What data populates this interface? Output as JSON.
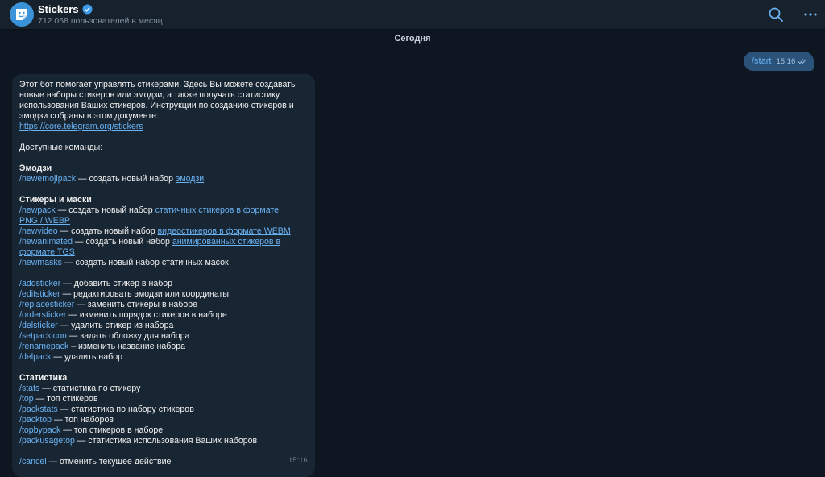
{
  "header": {
    "title": "Stickers",
    "subtitle": "712 068 пользователей в месяц",
    "icons": [
      "bot-avatar-icon",
      "verified-icon",
      "search-icon",
      "more-icon"
    ]
  },
  "chat": {
    "date_label": "Сегодня",
    "outgoing": {
      "text": "/start",
      "time": "15:16",
      "status": "read"
    },
    "incoming": {
      "time": "15:16",
      "intro": [
        "Этот бот помогает управлять стикерами. Здесь Вы можете создавать",
        "новые наборы стикеров или эмодзи, а также получать статистику",
        "использования Ваших стикеров. Инструкции по созданию стикеров и",
        "эмодзи собраны в этом документе:"
      ],
      "doc_link": "https://core.telegram.org/stickers",
      "commands_heading": "Доступные команды:",
      "emoji_heading": "Эмодзи",
      "newemojipack": {
        "cmd": "/newemojipack",
        "desc": " — создать новый набор ",
        "link": "эмодзи"
      },
      "stickers_heading": "Стикеры и маски",
      "newpack": {
        "cmd": "/newpack",
        "desc": " — создать новый набор ",
        "link1": "статичных стикеров в формате ",
        "link2": "PNG / WEBP"
      },
      "newvideo": {
        "cmd": "/newvideo",
        "desc": " — создать новый набор ",
        "link": "видеостикеров в формате WEBM"
      },
      "newanimated": {
        "cmd": "/newanimated",
        "desc": " — создать новый набор ",
        "link1": "анимированных стикеров в",
        "link2": "формате TGS"
      },
      "newmasks": {
        "cmd": "/newmasks",
        "desc": " — создать новый набор статичных масок"
      },
      "edit_commands": [
        {
          "cmd": "/addsticker",
          "desc": " — добавить стикер в набор"
        },
        {
          "cmd": "/editsticker",
          "desc": " — редактировать эмодзи или координаты"
        },
        {
          "cmd": "/replacesticker",
          "desc": " — заменить стикеры в наборе"
        },
        {
          "cmd": "/ordersticker",
          "desc": " — изменить порядок стикеров в наборе"
        },
        {
          "cmd": "/delsticker",
          "desc": " —  удалить стикер из набора"
        },
        {
          "cmd": "/setpackicon",
          "desc": " — задать обложку для набора"
        },
        {
          "cmd": "/renamepack",
          "desc": " – изменить название набора"
        },
        {
          "cmd": "/delpack",
          "desc": " — удалить набор"
        }
      ],
      "stats_heading": "Статистика",
      "stats_commands": [
        {
          "cmd": "/stats",
          "desc": " — статистика по стикеру"
        },
        {
          "cmd": "/top",
          "desc": " — топ стикеров"
        },
        {
          "cmd": "/packstats",
          "desc": " — статистика по набору стикеров"
        },
        {
          "cmd": "/packtop",
          "desc": " — топ наборов"
        },
        {
          "cmd": "/topbypack",
          "desc": " — топ стикеров в наборе"
        },
        {
          "cmd": "/packusagetop",
          "desc": " — статистика использования Ваших наборов"
        }
      ],
      "cancel": {
        "cmd": "/cancel",
        "desc": " — отменить текущее действие"
      }
    }
  },
  "colors": {
    "background": "#0e1621",
    "header": "#17212b",
    "outgoing_bubble": "#2b5278",
    "incoming_bubble": "#182533",
    "link": "#6ab3f3"
  }
}
